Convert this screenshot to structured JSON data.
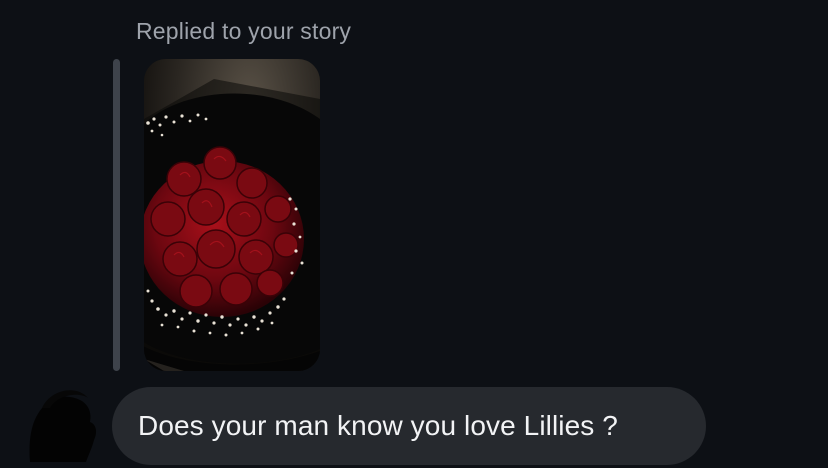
{
  "reply_context": {
    "label": "Replied to your story"
  },
  "story": {
    "thumbnail_icon": "red-roses-bouquet-image"
  },
  "sender": {
    "avatar_icon": "profile-avatar-dark"
  },
  "message": {
    "text": "Does your man know you love Lillies ?"
  },
  "colors": {
    "background": "#0d1015",
    "bubble": "#26292e",
    "label": "#9ea3ab",
    "quote_bar": "#3e434b",
    "rose": "#8b0a12"
  }
}
